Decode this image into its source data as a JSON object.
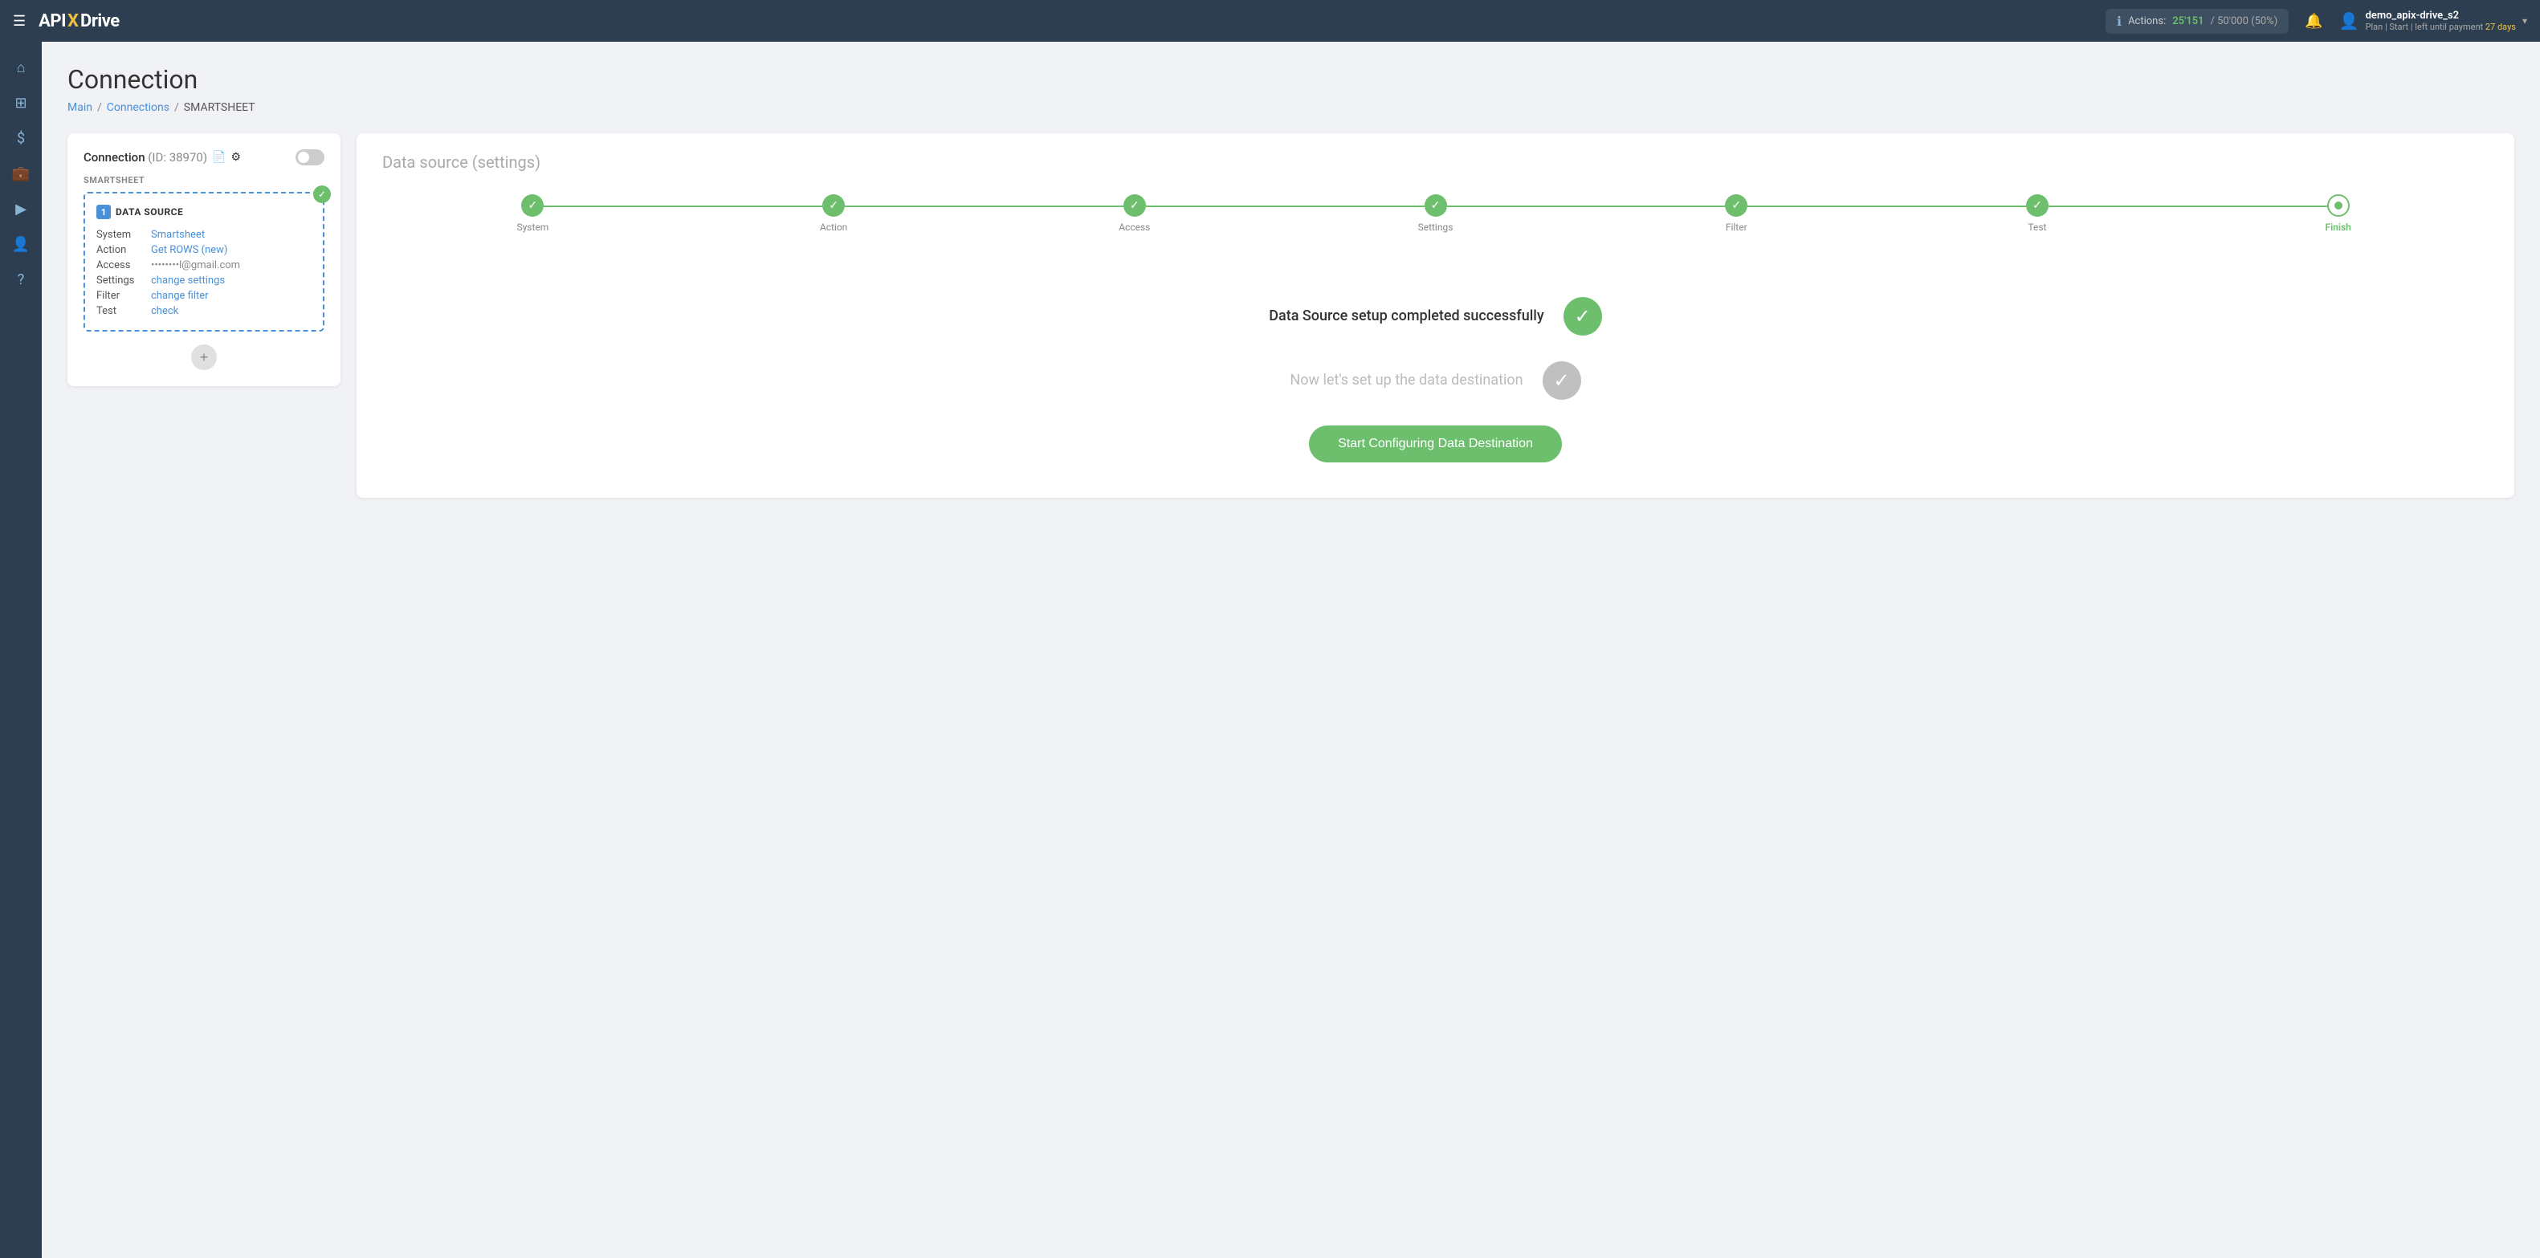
{
  "topbar": {
    "menu_icon": "☰",
    "logo_text_1": "API",
    "logo_x": "X",
    "logo_text_2": "Drive",
    "actions_label": "Actions:",
    "actions_used": "25'151",
    "actions_sep": "/",
    "actions_total": "50'000",
    "actions_pct": "(50%)",
    "bell_icon": "🔔",
    "user_icon": "👤",
    "user_name": "demo_apix-drive_s2",
    "user_plan": "Plan | Start | left until payment",
    "user_days": "27 days",
    "chevron": "▾"
  },
  "sidebar": {
    "items": [
      {
        "icon": "⌂",
        "name": "home"
      },
      {
        "icon": "⊞",
        "name": "dashboard"
      },
      {
        "icon": "$",
        "name": "billing"
      },
      {
        "icon": "💼",
        "name": "integrations"
      },
      {
        "icon": "▶",
        "name": "run"
      },
      {
        "icon": "👤",
        "name": "account"
      },
      {
        "icon": "?",
        "name": "help"
      }
    ]
  },
  "page": {
    "title": "Connection",
    "breadcrumb": {
      "main": "Main",
      "connections": "Connections",
      "current": "SMARTSHEET"
    }
  },
  "left_card": {
    "title_prefix": "Connection",
    "id_text": "(ID: 38970)",
    "doc_icon": "📄",
    "gear_icon": "⚙",
    "smartsheet_label": "SMARTSHEET",
    "data_source": {
      "num": "1",
      "header": "DATA SOURCE",
      "rows": [
        {
          "label": "System",
          "value": "Smartsheet",
          "type": "link"
        },
        {
          "label": "Action",
          "value": "Get ROWS (new)",
          "type": "link"
        },
        {
          "label": "Access",
          "value": "••••••••l@gmail.com",
          "type": "text"
        },
        {
          "label": "Settings",
          "value": "change settings",
          "type": "link"
        },
        {
          "label": "Filter",
          "value": "change filter",
          "type": "link"
        },
        {
          "label": "Test",
          "value": "check",
          "type": "link"
        }
      ]
    },
    "add_icon": "+"
  },
  "right_card": {
    "title": "Data source",
    "title_sub": "(settings)",
    "steps": [
      {
        "label": "System",
        "done": true
      },
      {
        "label": "Action",
        "done": true
      },
      {
        "label": "Access",
        "done": true
      },
      {
        "label": "Settings",
        "done": true
      },
      {
        "label": "Filter",
        "done": true
      },
      {
        "label": "Test",
        "done": true
      },
      {
        "label": "Finish",
        "done": true,
        "active": true
      }
    ],
    "success_title": "Data Source setup completed successfully",
    "next_title": "Now let's set up the data destination",
    "start_btn": "Start Configuring Data Destination"
  }
}
